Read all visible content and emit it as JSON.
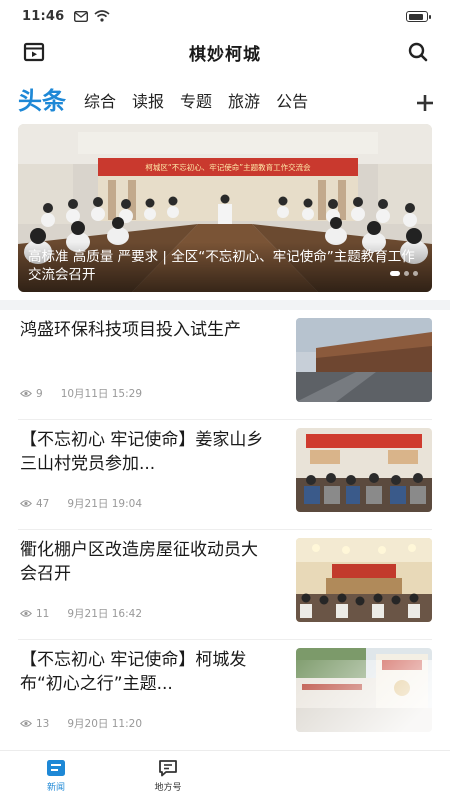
{
  "status_bar": {
    "time": "11:46"
  },
  "header": {
    "title": "棋妙柯城"
  },
  "tabs": [
    {
      "label": "头条",
      "active": true
    },
    {
      "label": "综合"
    },
    {
      "label": "读报"
    },
    {
      "label": "专题"
    },
    {
      "label": "旅游"
    },
    {
      "label": "公告"
    }
  ],
  "banner": {
    "caption": "高标准 高质量 严要求 | 全区“不忘初心、牢记使命”主题教育工作交流会召开",
    "stage_banner_text": "柯城区“不忘初心、牢记使命”主题教育工作交流会"
  },
  "news": [
    {
      "title": "鸿盛环保科技项目投入试生产",
      "views": "9",
      "date": "10月11日 15:29"
    },
    {
      "title": "【不忘初心 牢记使命】姜家山乡三山村党员参加...",
      "views": "47",
      "date": "9月21日 19:04"
    },
    {
      "title": "衢化棚户区改造房屋征收动员大会召开",
      "views": "11",
      "date": "9月21日 16:42"
    },
    {
      "title": "【不忘初心 牢记使命】柯城发布“初心之行”主题...",
      "views": "13",
      "date": "9月20日 11:20"
    }
  ],
  "bottom_nav": [
    {
      "label": "新闻",
      "icon": "news-icon",
      "active": true
    },
    {
      "label": "地方号",
      "icon": "chat-icon"
    }
  ],
  "colors": {
    "accent": "#1e88d6",
    "meta": "#999999"
  }
}
